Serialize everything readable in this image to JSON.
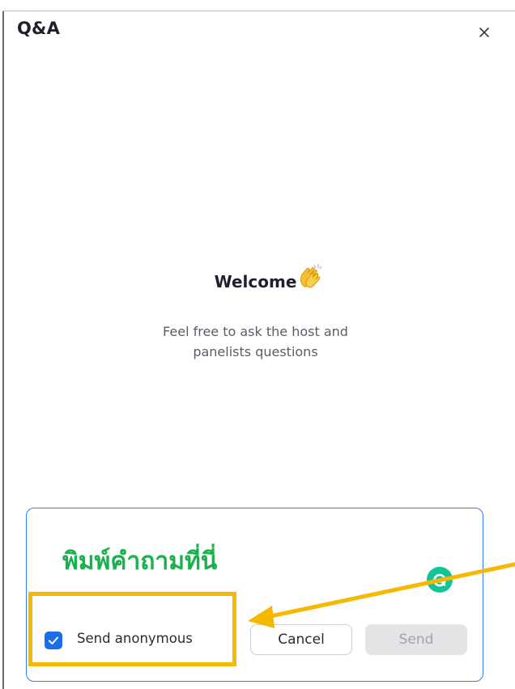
{
  "window": {
    "title": "Q&A",
    "close_symbol": "×"
  },
  "welcome": {
    "title": "Welcome",
    "icon": "clapping-hands-icon",
    "subtitle_line1": "Feel free to ask the host and",
    "subtitle_line2": "panelists questions"
  },
  "composer": {
    "annotation_text": "พิมพ์คำถามที่นี่",
    "grammarly_icon": "grammarly-icon",
    "send_anonymous_label": "Send anonymous",
    "send_anonymous_checked": true,
    "cancel_label": "Cancel",
    "send_label": "Send",
    "send_enabled": false
  },
  "colors": {
    "accent_blue": "#1a6fe8",
    "annotation_green": "#1bb04e",
    "annotation_orange": "#f6b800",
    "grammarly_green": "#15c39a"
  }
}
